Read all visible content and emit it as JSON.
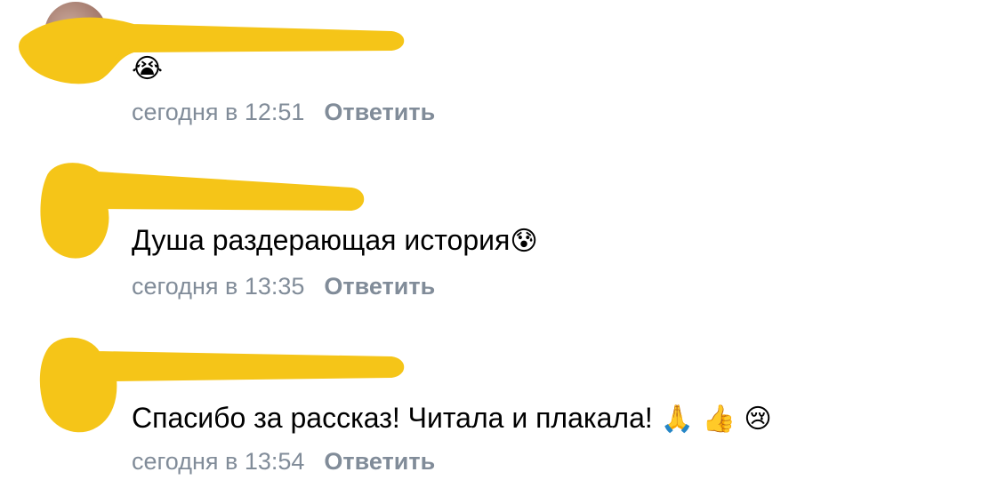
{
  "comments": [
    {
      "message": "",
      "emoji": "😭",
      "time": "сегодня в 12:51",
      "reply_label": "Ответить"
    },
    {
      "message": "Душа раздерающая история",
      "emoji": "😰",
      "time": "сегодня в 13:35",
      "reply_label": "Ответить"
    },
    {
      "message": "Спасибо за рассказ! Читала и плакала!",
      "emoji": "🙏 👍 😢",
      "time": "сегодня в 13:54",
      "reply_label": "Ответить"
    }
  ],
  "colors": {
    "redaction": "#f5c518",
    "meta_text": "#818c99",
    "message_text": "#000000"
  }
}
